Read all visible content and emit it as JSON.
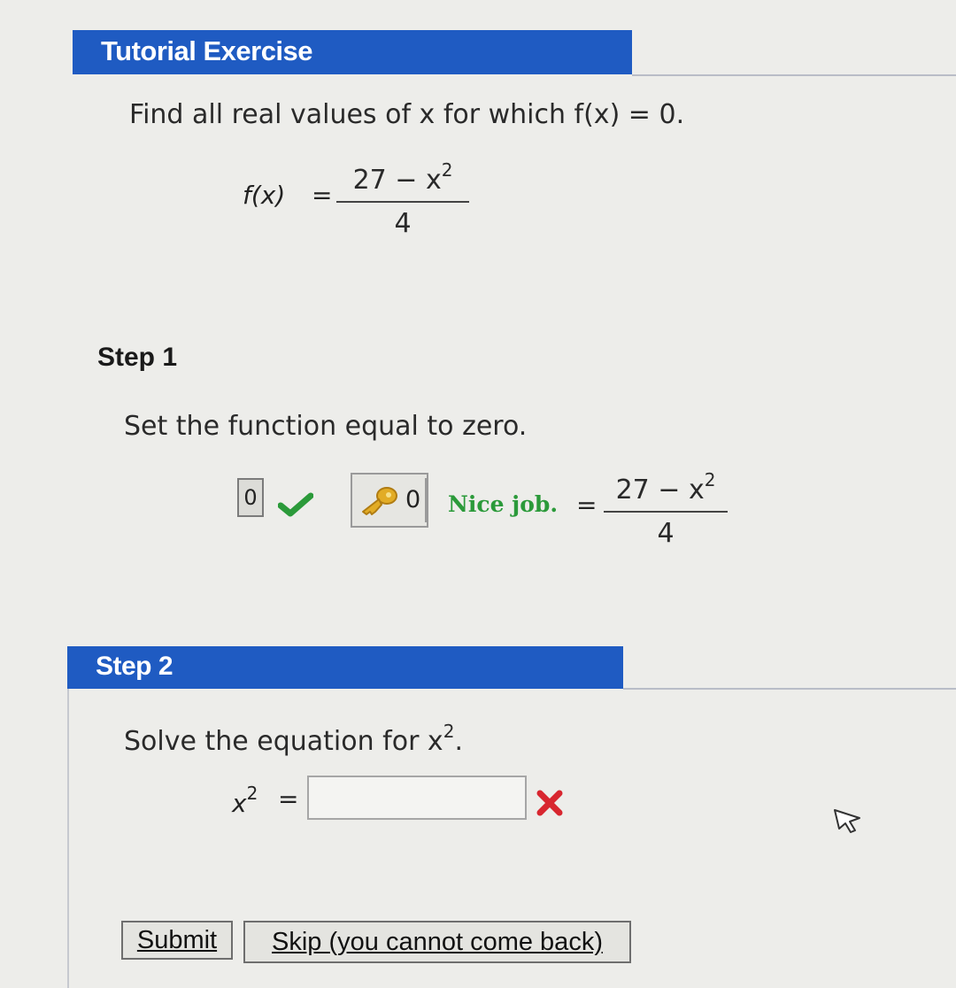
{
  "header": {
    "title": "Tutorial Exercise"
  },
  "problem": {
    "prompt": "Find all real values of x for which f(x) = 0.",
    "function_lhs": "f(x)",
    "equals": "=",
    "numerator": "27 − x",
    "exponent": "2",
    "denominator": "4"
  },
  "step1": {
    "label": "Step 1",
    "instruction": "Set the function equal to zero.",
    "answer_value": "0",
    "key_value": "0",
    "feedback": "Nice job.",
    "equals": "=",
    "numerator": "27 − x",
    "exponent": "2",
    "denominator": "4",
    "status": "correct"
  },
  "step2": {
    "label": "Step 2",
    "instruction": "Solve the equation for x",
    "instruction_exponent": "2",
    "instruction_end": ".",
    "input_label": "x",
    "input_exponent": "2",
    "equals": "=",
    "input_value": "",
    "status": "incorrect"
  },
  "buttons": {
    "submit": "Submit",
    "skip": "Skip (you cannot come back)"
  },
  "colors": {
    "header_bg": "#1f5bc2",
    "correct": "#2b9a3a",
    "incorrect": "#d8262f",
    "key": "#d8a21c"
  },
  "icons": {
    "correct": "check-icon",
    "incorrect": "x-icon",
    "key": "key-icon",
    "cursor": "mouse-cursor-icon"
  }
}
